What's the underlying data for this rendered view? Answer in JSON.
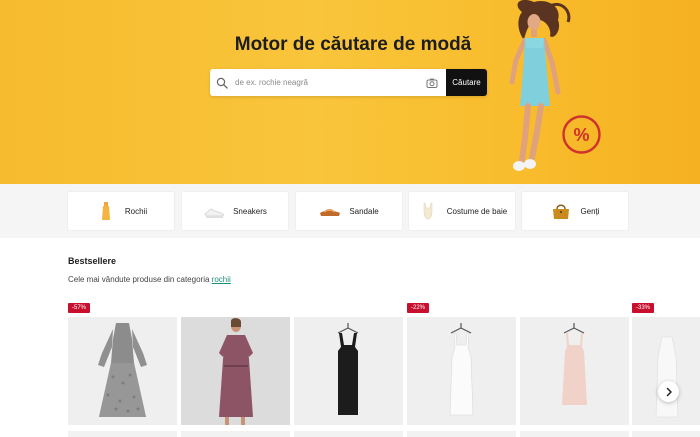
{
  "hero": {
    "title": "Motor de căutare de modă",
    "search": {
      "placeholder": "de ex. rochie neagră",
      "button_label": "Căutare"
    },
    "sale_badge_text": "%",
    "colors": {
      "background": "#f8c036",
      "button": "#111111",
      "badge": "#d0312d"
    }
  },
  "categories": [
    {
      "label": "Rochii",
      "icon": "dress-icon"
    },
    {
      "label": "Sneakers",
      "icon": "sneaker-icon"
    },
    {
      "label": "Sandale",
      "icon": "sandal-icon"
    },
    {
      "label": "Costume de baie",
      "icon": "swimsuit-icon"
    },
    {
      "label": "Genți",
      "icon": "handbag-icon"
    }
  ],
  "bestsellers": {
    "title": "Bestsellere",
    "subtitle_prefix": "Cele mai vândute produse din categoria ",
    "subtitle_link": "rochii",
    "products": [
      {
        "discount": "-57%",
        "image": "grey-floral-dress"
      },
      {
        "discount": "",
        "image": "mauve-dress-on-model"
      },
      {
        "discount": "",
        "image": "black-knit-dress"
      },
      {
        "discount": "-22%",
        "image": "white-slip-dress"
      },
      {
        "discount": "",
        "image": "pink-mini-dress"
      },
      {
        "discount": "-33%",
        "image": "white-dress-partial"
      }
    ]
  },
  "accent_colors": {
    "discount_badge": "#c8102e",
    "link": "#1a8f7a"
  }
}
